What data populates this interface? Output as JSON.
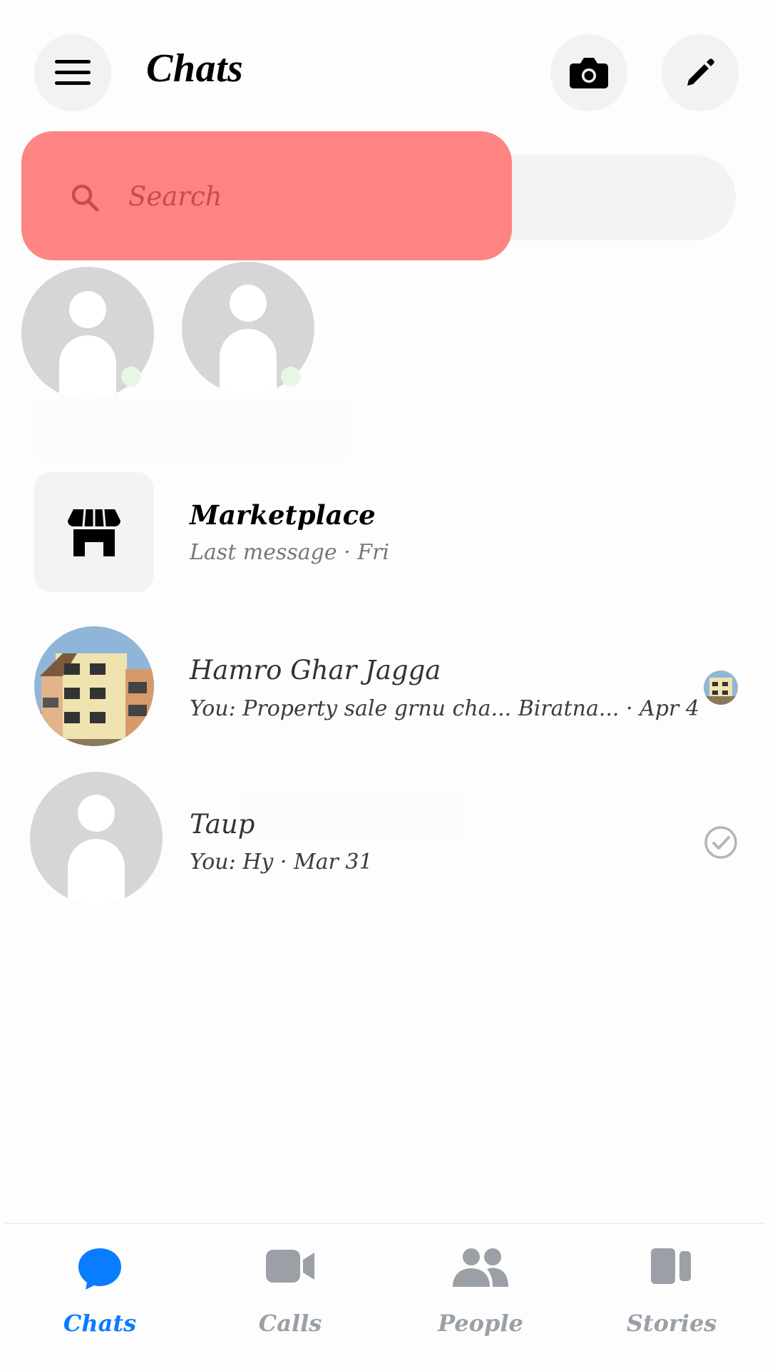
{
  "header": {
    "title": "Chats",
    "menu_icon": "hamburger-menu-icon",
    "camera_icon": "camera-icon",
    "compose_icon": "pencil-icon"
  },
  "search": {
    "placeholder": "Search",
    "icon": "search-icon",
    "highlight_color": "#ff6e6e"
  },
  "stories": [
    {
      "avatar": "default-person-icon"
    },
    {
      "avatar": "default-person-icon"
    }
  ],
  "chats": [
    {
      "name": "Marketplace",
      "preview": "Last message · Fri",
      "avatar": "storefront-icon"
    },
    {
      "name": "Hamro Ghar Jagga",
      "preview": "You: Property sale grnu cha... Biratna... · Apr 4",
      "avatar": "house-photo",
      "status": "seen-avatar"
    },
    {
      "name": "Taup",
      "preview": "You: Hy · Mar 31",
      "avatar": "default-person-icon",
      "status": "sent-check-icon"
    }
  ],
  "bottom_nav": {
    "items": [
      {
        "label": "Chats",
        "icon": "chat-bubble-icon",
        "active": true
      },
      {
        "label": "Calls",
        "icon": "video-camera-icon",
        "active": false
      },
      {
        "label": "People",
        "icon": "people-icon",
        "active": false
      },
      {
        "label": "Stories",
        "icon": "stories-icon",
        "active": false
      }
    ],
    "active_color": "#0a7cff",
    "inactive_color": "#9aa0a6"
  }
}
